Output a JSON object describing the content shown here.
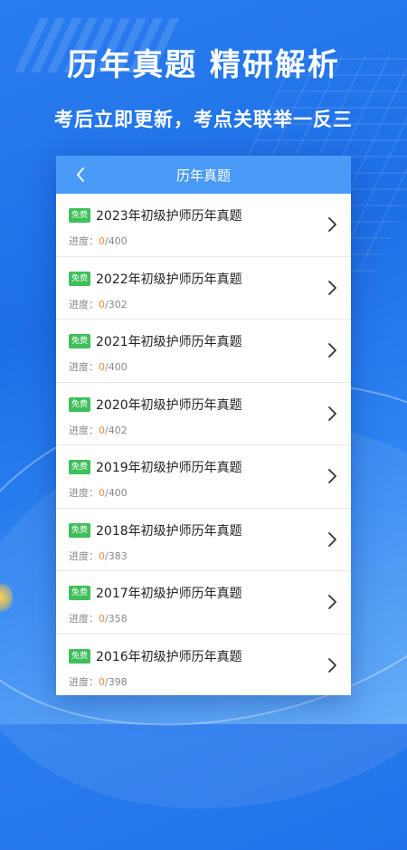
{
  "promo": {
    "headline": "历年真题 精研解析",
    "subline": "考后立即更新，考点关联举一反三"
  },
  "screen": {
    "nav_title": "历年真题",
    "items": [
      {
        "badge": "免费",
        "title": "2023年初级护师历年真题",
        "progress_label": "进度：",
        "done": "0",
        "total": "/400"
      },
      {
        "badge": "免费",
        "title": "2022年初级护师历年真题",
        "progress_label": "进度：",
        "done": "0",
        "total": "/302"
      },
      {
        "badge": "免费",
        "title": "2021年初级护师历年真题",
        "progress_label": "进度：",
        "done": "0",
        "total": "/400"
      },
      {
        "badge": "免费",
        "title": "2020年初级护师历年真题",
        "progress_label": "进度：",
        "done": "0",
        "total": "/402"
      },
      {
        "badge": "免费",
        "title": "2019年初级护师历年真题",
        "progress_label": "进度：",
        "done": "0",
        "total": "/400"
      },
      {
        "badge": "免费",
        "title": "2018年初级护师历年真题",
        "progress_label": "进度：",
        "done": "0",
        "total": "/383"
      },
      {
        "badge": "免费",
        "title": "2017年初级护师历年真题",
        "progress_label": "进度：",
        "done": "0",
        "total": "/358"
      },
      {
        "badge": "免费",
        "title": "2016年初级护师历年真题",
        "progress_label": "进度：",
        "done": "0",
        "total": "/398"
      }
    ]
  },
  "colors": {
    "nav_bar": "#4a9bf7",
    "badge": "#3fbf5a",
    "progress_done": "#f08a3c",
    "background": "#1e6fe6"
  },
  "icons": {
    "back": "chevron-left-icon",
    "row_arrow": "chevron-right-icon"
  }
}
